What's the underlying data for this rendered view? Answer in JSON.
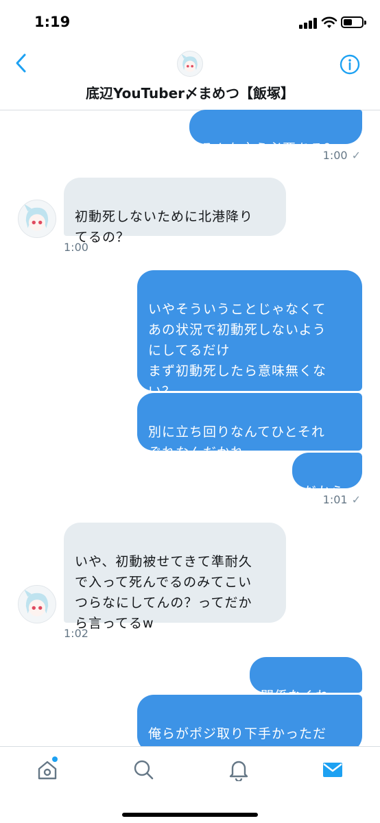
{
  "status_bar": {
    "time": "1:19"
  },
  "header": {
    "title": "底辺YouTuber〆まめつ【飯塚】",
    "avatar_icon": "anime-avatar"
  },
  "messages": [
    {
      "text": "そんな言う必要ある？"
    },
    {
      "text": "1:00",
      "check": "✓"
    },
    {
      "text": "初動死しないために北港降り\nてるの？"
    },
    {
      "text": "1:00"
    },
    {
      "text": "いやそういうことじゃなくて\nあの状況で初動死しないよう\nにしてるだけ\nまず初動死したら意味無くな\nい？"
    },
    {
      "text": "別に立ち回りなんてひとそれ\nぞれなんだかれ"
    },
    {
      "text": "だから"
    },
    {
      "text": "1:01",
      "check": "✓"
    },
    {
      "text": "いや、初動被せてきて準耐久\nで入って死んでるのみてこい\nつらなにしてんの？ってだか\nら言ってるw"
    },
    {
      "text": "1:02"
    },
    {
      "text": "関係なくねw"
    },
    {
      "text": "俺らがポジ取り下手かっただ\nけでどうでもよくねそんなの"
    }
  ],
  "tabbar": {
    "items": [
      "home-icon",
      "search-icon",
      "notifications-icon",
      "messages-icon"
    ],
    "active": "messages-icon",
    "accent_color": "#1da1f2"
  }
}
